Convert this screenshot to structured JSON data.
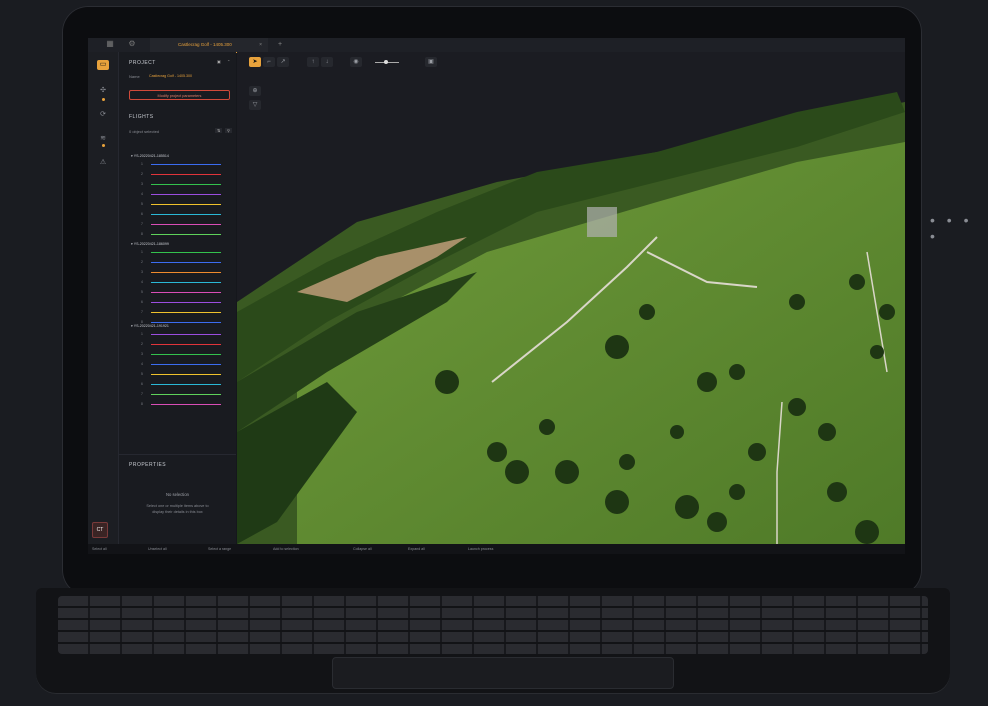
{
  "window": {
    "tab_title": "Castlecrag Golf - 1405.300",
    "tab_close": "×",
    "tab_add": "+"
  },
  "project": {
    "heading": "PROJECT",
    "name_label": "Name",
    "name_value": "Castlecrag Golf - 1405.300",
    "modify_button": "Modify project parameters"
  },
  "flights": {
    "heading": "FLIGHTS",
    "selection_text": "0 object selected",
    "groups": [
      {
        "label": "▾ YS-20220421-185514",
        "lines": [
          {
            "n": "1",
            "color": "#3b6cf0"
          },
          {
            "n": "2",
            "color": "#e0343a"
          },
          {
            "n": "3",
            "color": "#33c24d"
          },
          {
            "n": "4",
            "color": "#9b4de0"
          },
          {
            "n": "5",
            "color": "#f0c22b"
          },
          {
            "n": "6",
            "color": "#2ab8d6"
          },
          {
            "n": "7",
            "color": "#d94db6"
          },
          {
            "n": "8",
            "color": "#5ed35a"
          }
        ]
      },
      {
        "label": "▾ YS-20220421-186099",
        "lines": [
          {
            "n": "1",
            "color": "#33c24d"
          },
          {
            "n": "2",
            "color": "#3b6cf0"
          },
          {
            "n": "3",
            "color": "#f08a2b"
          },
          {
            "n": "4",
            "color": "#2ab8d6"
          },
          {
            "n": "5",
            "color": "#d94db6"
          },
          {
            "n": "6",
            "color": "#9b4de0"
          },
          {
            "n": "7",
            "color": "#f0c22b"
          },
          {
            "n": "8",
            "color": "#3b6cf0"
          }
        ]
      },
      {
        "label": "▾ YS-20220421-191921",
        "lines": [
          {
            "n": "1",
            "color": "#9b4de0"
          },
          {
            "n": "2",
            "color": "#e0343a"
          },
          {
            "n": "3",
            "color": "#33c24d"
          },
          {
            "n": "4",
            "color": "#3b6cf0"
          },
          {
            "n": "5",
            "color": "#f0c22b"
          },
          {
            "n": "6",
            "color": "#2ab8d6"
          },
          {
            "n": "7",
            "color": "#5ed35a"
          },
          {
            "n": "8",
            "color": "#d94db6"
          }
        ]
      }
    ]
  },
  "properties": {
    "heading": "PROPERTIES",
    "empty_title": "No selection",
    "empty_line1": "Select one or multiple items above to",
    "empty_line2": "display their details in this box"
  },
  "statusbar": {
    "items": [
      "Select all",
      "Unselect all",
      "Select a range",
      "Add to selection",
      "Collapse all",
      "Expand all",
      "Launch process"
    ]
  },
  "brand_badge": "CT",
  "icons": {
    "rail": [
      "folder-icon",
      "drone-icon",
      "history-icon",
      "layers-icon",
      "warning-icon"
    ],
    "toolbar": [
      "pointer-icon",
      "measure-icon",
      "pin-icon",
      "arrow-up-icon",
      "arrow-down-icon",
      "eye-icon",
      "camera-icon"
    ]
  },
  "colors": {
    "accent": "#e8a23c",
    "danger": "#d14a3a"
  }
}
